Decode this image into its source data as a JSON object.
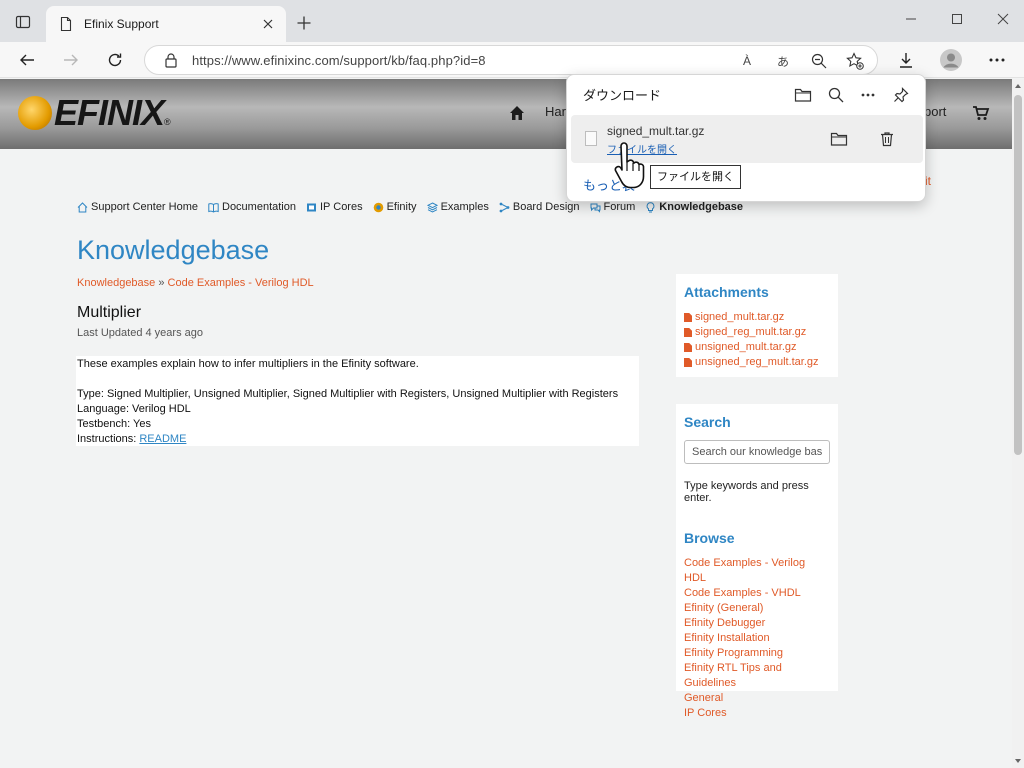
{
  "browser": {
    "tab_title": "Efinix Support",
    "url": "https://www.efinixinc.com/support/kb/faq.php?id=8",
    "read_aloud_label": "À",
    "translate_label": "あ",
    "icons": [
      "tab-actions-icon",
      "page-icon",
      "close-icon",
      "plus-icon",
      "minimize-icon",
      "maximize-icon",
      "close-window-icon",
      "back-icon",
      "forward-icon",
      "refresh-icon",
      "lock-icon",
      "read-aloud-icon",
      "translate-icon",
      "zoom-out-icon",
      "favorites-icon",
      "download-icon",
      "profile-icon",
      "more-icon"
    ]
  },
  "site": {
    "logo_text": "EFINIX",
    "logo_tm": "®",
    "nav_hard": "Har",
    "nav_support": "port",
    "subnav": [
      {
        "label": "Support Center Home",
        "icon": "home-icon"
      },
      {
        "label": "Documentation",
        "icon": "book-icon"
      },
      {
        "label": "IP Cores",
        "icon": "chip-icon"
      },
      {
        "label": "Efinity",
        "icon": "efinity-icon"
      },
      {
        "label": "Examples",
        "icon": "layers-icon"
      },
      {
        "label": "Board Design",
        "icon": "board-icon"
      },
      {
        "label": "Forum",
        "icon": "forum-icon"
      },
      {
        "label": "Knowledgebase",
        "icon": "bulb-icon"
      }
    ]
  },
  "article": {
    "section_title": "Knowledgebase",
    "breadcrumb": {
      "root": "Knowledgebase",
      "sep": "»",
      "category": "Code Examples - Verilog HDL"
    },
    "title": "Multiplier",
    "updated": "Last Updated 4 years ago",
    "intro": "These examples explain how to infer multipliers in the Efinity software.",
    "type_line": "Type: Signed Multiplier, Unsigned Multiplier, Signed Multiplier with Registers, Unsigned Multiplier with Registers",
    "language_line": "Language: Verilog HDL",
    "testbench_line": "Testbench: Yes",
    "instructions_label": "Instructions: ",
    "readme_link": "README"
  },
  "sidebar": {
    "attachments_title": "Attachments",
    "attachments": [
      "signed_mult.tar.gz",
      "signed_reg_mult.tar.gz",
      "unsigned_mult.tar.gz",
      "unsigned_reg_mult.tar.gz"
    ],
    "search_title": "Search",
    "search_placeholder": "Search our knowledge base",
    "search_hint": "Type keywords and press enter.",
    "browse_title": "Browse",
    "browse": [
      "Code Examples - Verilog HDL",
      "Code Examples - VHDL",
      "Efinity (General)",
      "Efinity Debugger",
      "Efinity Installation",
      "Efinity Programming",
      "Efinity RTL Tips and Guidelines",
      "General",
      "IP Cores"
    ]
  },
  "downloads": {
    "title": "ダウンロード",
    "file_name": "signed_mult.tar.gz",
    "open_link": "ファイルを開く",
    "more_link": "もっと表",
    "tooltip": "ファイルを開く",
    "peek_text": "it"
  }
}
